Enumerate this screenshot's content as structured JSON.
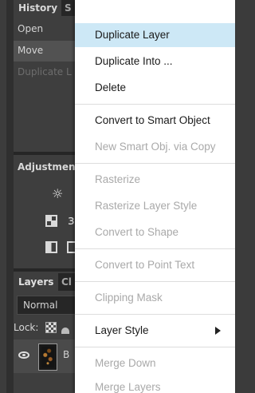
{
  "left_panel": {
    "tabs": {
      "history": "History",
      "second": "S"
    },
    "history_items": [
      "Open",
      "Move",
      "Duplicate L"
    ],
    "adjustments_title": "Adjustmen",
    "layers_tabs": {
      "layers": "Layers",
      "second": "Cl"
    },
    "blend_mode": "Normal",
    "lock_label": "Lock:",
    "layer_name": "B"
  },
  "context_menu": {
    "items": [
      {
        "label": "Duplicate Layer",
        "state": "highlighted"
      },
      {
        "label": "Duplicate Into ...",
        "state": "enabled"
      },
      {
        "label": "Delete",
        "state": "enabled"
      },
      {
        "label": "Convert to Smart Object",
        "state": "enabled"
      },
      {
        "label": "New Smart Obj. via Copy",
        "state": "disabled"
      },
      {
        "label": "Rasterize",
        "state": "disabled"
      },
      {
        "label": "Rasterize Layer Style",
        "state": "disabled"
      },
      {
        "label": "Convert to Shape",
        "state": "disabled"
      },
      {
        "label": "Convert to Point Text",
        "state": "disabled"
      },
      {
        "label": "Clipping Mask",
        "state": "disabled"
      },
      {
        "label": "Layer Style",
        "state": "enabled",
        "submenu": true
      },
      {
        "label": "Merge Down",
        "state": "disabled"
      },
      {
        "label": "Merge Layers",
        "state": "disabled"
      }
    ]
  },
  "colors": {
    "highlight": "#cde8f6",
    "disabled_text": "#a9a9a9",
    "panel_bg": "#3e3e3e"
  }
}
